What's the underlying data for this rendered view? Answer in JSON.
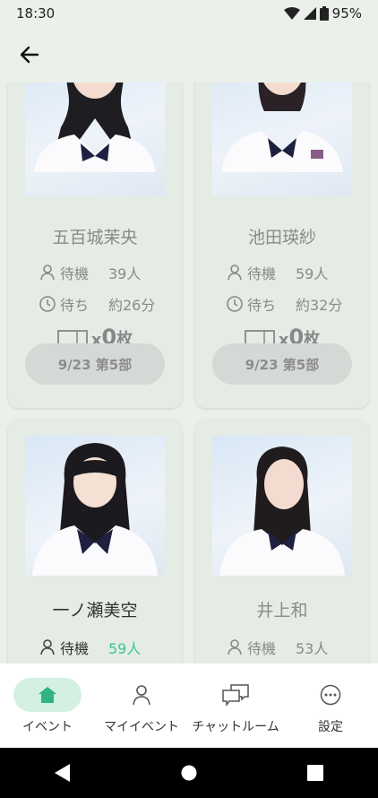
{
  "status_bar": {
    "time": "18:30",
    "battery": "95%"
  },
  "members": [
    {
      "name": "五百城茉央",
      "wait_label": "待機",
      "wait_count": "39人",
      "time_label": "待ち",
      "time_value": "約26分",
      "ticket_x": "x",
      "ticket_count": "0",
      "ticket_unit": "枚",
      "slot": "9/23 第5部"
    },
    {
      "name": "池田瑛紗",
      "wait_label": "待機",
      "wait_count": "59人",
      "time_label": "待ち",
      "time_value": "約32分",
      "ticket_x": "x",
      "ticket_count": "0",
      "ticket_unit": "枚",
      "slot": "9/23 第5部"
    },
    {
      "name": "一ノ瀬美空",
      "wait_label": "待機",
      "wait_count": "59人"
    },
    {
      "name": "井上和",
      "wait_label": "待機",
      "wait_count": "53人"
    }
  ],
  "bottom_nav": [
    {
      "label": "イベント",
      "icon": "home-icon",
      "active": true
    },
    {
      "label": "マイイベント",
      "icon": "person-icon"
    },
    {
      "label": "チャットルーム",
      "icon": "chat-icon"
    },
    {
      "label": "設定",
      "icon": "more-icon"
    }
  ],
  "colors": {
    "background": "#ebf0eb",
    "card": "#e5ece6",
    "accent": "#3cc58f",
    "nav_active": "#d3f0e3",
    "button": "#d4d9d5"
  }
}
